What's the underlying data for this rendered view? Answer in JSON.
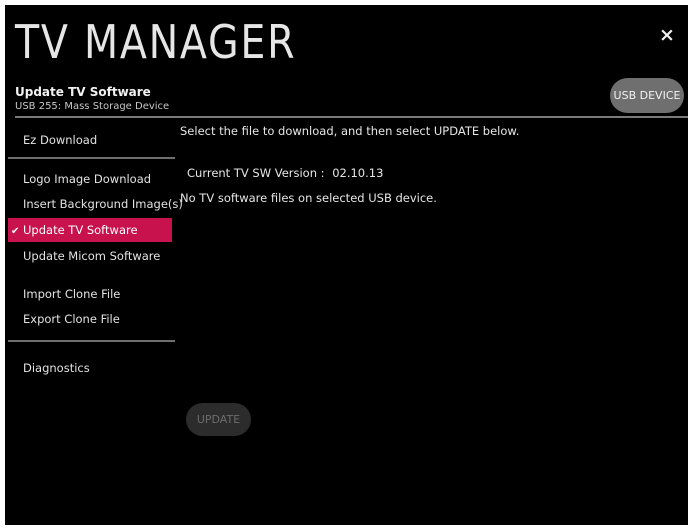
{
  "header": {
    "title": "TV MANAGER",
    "subtitle": "Update TV Software",
    "device": "USB 255: Mass Storage Device",
    "close_icon_glyph": "×",
    "usb_button_label": "USB DEVICE"
  },
  "sidebar": {
    "items": [
      {
        "label": "Ez Download",
        "selected": false
      },
      {
        "label": "Logo Image Download",
        "selected": false
      },
      {
        "label": "Insert Background Image(s)",
        "selected": false
      },
      {
        "label": "Update TV Software",
        "selected": true
      },
      {
        "label": "Update Micom Software",
        "selected": false
      },
      {
        "label": "Import Clone File",
        "selected": false
      },
      {
        "label": "Export Clone File",
        "selected": false
      },
      {
        "label": "Diagnostics",
        "selected": false
      }
    ],
    "check_glyph": "✔",
    "active_color": "#c8124d"
  },
  "main": {
    "instruction": "Select the file to download, and then select UPDATE below.",
    "version_label": "Current TV SW Version :",
    "version_value": "02.10.13",
    "status": "No TV software files on selected USB device.",
    "update_button_label": "UPDATE",
    "update_button_enabled": false
  }
}
